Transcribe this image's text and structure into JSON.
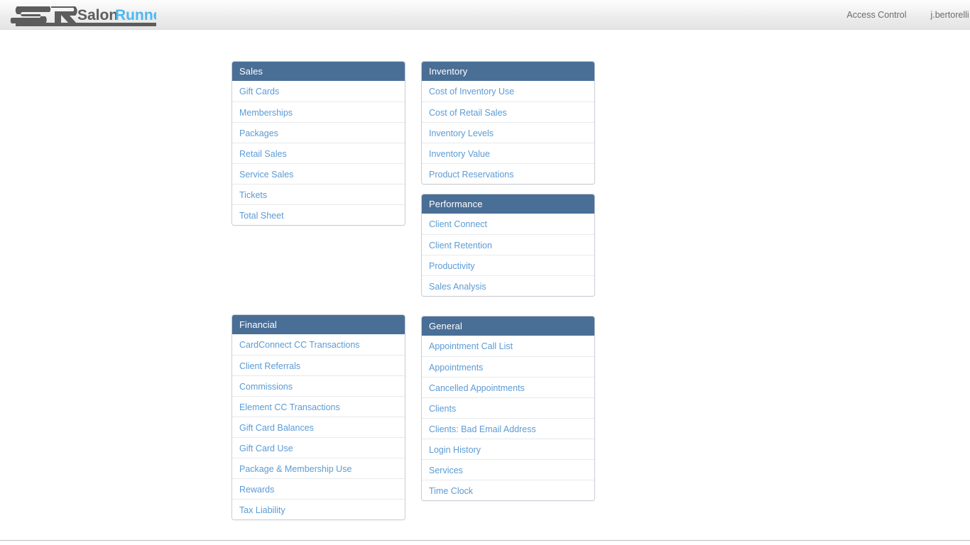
{
  "header": {
    "logo": {
      "mark": "SR",
      "word_dark": "Salon",
      "word_light": "Runner",
      "dark_color": "#5c5c5c",
      "light_color": "#4db8f0"
    },
    "nav": [
      {
        "label": "Access Control",
        "name": "access-control"
      }
    ],
    "user_label": "j.bertorelli salon: H"
  },
  "theme": {
    "panel_header_bg": "#4a6f97",
    "panel_header_text": "#ffffff",
    "link_color": "#5b9bd5",
    "panel_border": "#c8cdd3",
    "row_divider": "#e7e9eb",
    "page_bg": "#ffffff",
    "topbar_text": "#6c6c6c"
  },
  "columns": [
    {
      "name": "left-column",
      "panels": [
        {
          "name": "sales",
          "title": "Sales",
          "items": [
            "Gift Cards",
            "Memberships",
            "Packages",
            "Retail Sales",
            "Service Sales",
            "Tickets",
            "Total Sheet"
          ]
        },
        {
          "name": "financial",
          "title": "Financial",
          "items": [
            "CardConnect CC Transactions",
            "Client Referrals",
            "Commissions",
            "Element CC Transactions",
            "Gift Card Balances",
            "Gift Card Use",
            "Package & Membership Use",
            "Rewards",
            "Tax Liability"
          ]
        }
      ]
    },
    {
      "name": "right-column",
      "panels": [
        {
          "name": "inventory",
          "title": "Inventory",
          "items": [
            "Cost of Inventory Use",
            "Cost of Retail Sales",
            "Inventory Levels",
            "Inventory Value",
            "Product Reservations"
          ]
        },
        {
          "name": "performance",
          "title": "Performance",
          "items": [
            "Client Connect",
            "Client Retention",
            "Productivity",
            "Sales Analysis"
          ]
        },
        {
          "name": "general",
          "title": "General",
          "items": [
            "Appointment Call List",
            "Appointments",
            "Cancelled Appointments",
            "Clients",
            "Clients: Bad Email Address",
            "Login History",
            "Services",
            "Time Clock"
          ]
        }
      ]
    }
  ]
}
